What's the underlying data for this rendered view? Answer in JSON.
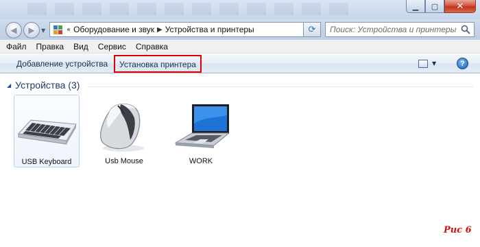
{
  "address": {
    "back_icon": "back-arrow-icon",
    "forward_icon": "forward-arrow-icon",
    "overflow": "«",
    "crumbs": [
      "Оборудование и звук",
      "Устройства и принтеры"
    ],
    "search_placeholder": "Поиск: Устройства и принтеры"
  },
  "menu": [
    "Файл",
    "Правка",
    "Вид",
    "Сервис",
    "Справка"
  ],
  "commands": {
    "add_device": "Добавление устройства",
    "install_printer": "Установка принтера",
    "highlight_color": "#e00000"
  },
  "group": {
    "title": "Устройства (3)"
  },
  "devices": [
    {
      "label": "USB Keyboard",
      "icon": "keyboard-icon",
      "selected": true
    },
    {
      "label": "Usb Mouse",
      "icon": "mouse-icon",
      "selected": false
    },
    {
      "label": "WORK",
      "icon": "laptop-icon",
      "selected": false
    }
  ],
  "figure_label": "Рис 6"
}
